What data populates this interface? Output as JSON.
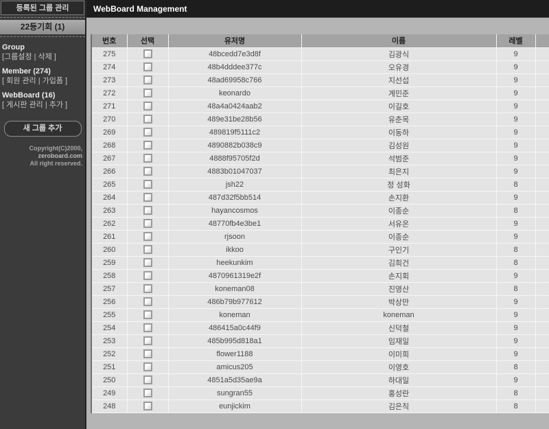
{
  "colors": {
    "titlebar_bg": "#1d1d1d",
    "sidebar_bg": "#3b3b3b",
    "table_header_bg": "#a3a3a3",
    "row_bg": "#e4e4e4"
  },
  "sidebar": {
    "header": "등록된 그룹 관리",
    "group_title": "22등기회 (1)",
    "sections": [
      {
        "title": "Group",
        "links": "[그룹설정 | 삭제 ]"
      },
      {
        "title": "Member (274)",
        "links": "[ 회원 관리 | 가입폼 ]"
      },
      {
        "title": "WebBoard (16)",
        "links": "[ 게시판 관리 | 추가 ]"
      }
    ],
    "new_group_button": "새 그룹 추가",
    "copyright_line1": "Copyright(C)2000,",
    "copyright_brand": "zeroboard.com",
    "copyright_line2": "All right reserved."
  },
  "header": {
    "title": "WebBoard Management"
  },
  "table": {
    "columns": [
      "번호",
      "선택",
      "유저명",
      "이름",
      "레벨"
    ],
    "rows": [
      {
        "no": "275",
        "username": "48bcedd7e3d8f",
        "name": "김광식",
        "level": "9"
      },
      {
        "no": "274",
        "username": "48b4dddee377c",
        "name": "오유경",
        "level": "9"
      },
      {
        "no": "273",
        "username": "48ad69958c766",
        "name": "지선섭",
        "level": "9"
      },
      {
        "no": "272",
        "username": "keonardo",
        "name": "계민준",
        "level": "9"
      },
      {
        "no": "271",
        "username": "48a4a0424aab2",
        "name": "이길호",
        "level": "9"
      },
      {
        "no": "270",
        "username": "489e31be28b56",
        "name": "유춘목",
        "level": "9"
      },
      {
        "no": "269",
        "username": "489819f5111c2",
        "name": "이동하",
        "level": "9"
      },
      {
        "no": "268",
        "username": "4890882b038c9",
        "name": "김성원",
        "level": "9"
      },
      {
        "no": "267",
        "username": "4888f95705f2d",
        "name": "석범준",
        "level": "9"
      },
      {
        "no": "266",
        "username": "4883b01047037",
        "name": "최은지",
        "level": "9"
      },
      {
        "no": "265",
        "username": "jsh22",
        "name": "정 성화",
        "level": "8"
      },
      {
        "no": "264",
        "username": "487d32f5bb514",
        "name": "손지환",
        "level": "9"
      },
      {
        "no": "263",
        "username": "hayancosmos",
        "name": "이종순",
        "level": "8"
      },
      {
        "no": "262",
        "username": "48770fb4e3be1",
        "name": "서유온",
        "level": "9"
      },
      {
        "no": "261",
        "username": "rjsoon",
        "name": "이종순",
        "level": "9"
      },
      {
        "no": "260",
        "username": "ikkoo",
        "name": "구인기",
        "level": "8"
      },
      {
        "no": "259",
        "username": "heekunkim",
        "name": "김희건",
        "level": "8"
      },
      {
        "no": "258",
        "username": "4870961319e2f",
        "name": "손지회",
        "level": "9"
      },
      {
        "no": "257",
        "username": "koneman08",
        "name": "진영산",
        "level": "8"
      },
      {
        "no": "256",
        "username": "486b79b977612",
        "name": "박상만",
        "level": "9"
      },
      {
        "no": "255",
        "username": "koneman",
        "name": "koneman",
        "level": "9"
      },
      {
        "no": "254",
        "username": "486415a0c44f9",
        "name": "신덕철",
        "level": "9"
      },
      {
        "no": "253",
        "username": "485b995d818a1",
        "name": "임재일",
        "level": "9"
      },
      {
        "no": "252",
        "username": "flower1188",
        "name": "이미희",
        "level": "9"
      },
      {
        "no": "251",
        "username": "amicus205",
        "name": "이영호",
        "level": "8"
      },
      {
        "no": "250",
        "username": "4851a5d35ae9a",
        "name": "하대일",
        "level": "9"
      },
      {
        "no": "249",
        "username": "sungran55",
        "name": "홍성란",
        "level": "8"
      },
      {
        "no": "248",
        "username": "eunjickim",
        "name": "김은직",
        "level": "8"
      }
    ]
  }
}
